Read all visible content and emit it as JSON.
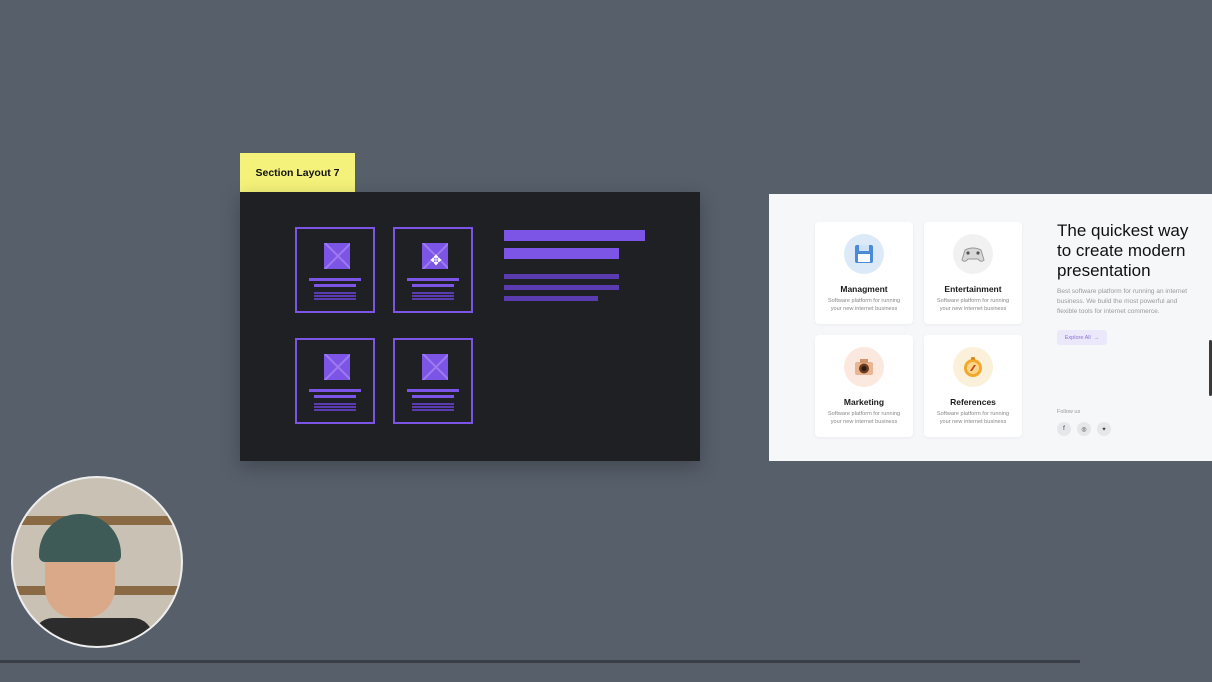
{
  "section_label": "Section Layout 7",
  "colors": {
    "background": "#575f6b",
    "wireframe_bg": "#1f2024",
    "wireframe_accent": "#7d55e6",
    "label_bg": "#f4f27a",
    "preview_bg": "#f6f7f9"
  },
  "preview": {
    "features": [
      {
        "title": "Managment",
        "desc": "Software platform for running your new internet business",
        "icon": "floppy-disk-icon"
      },
      {
        "title": "Entertainment",
        "desc": "Software platform for running your new internet business",
        "icon": "gamepad-icon"
      },
      {
        "title": "Marketing",
        "desc": "Software platform for running your new internet business",
        "icon": "camera-icon"
      },
      {
        "title": "References",
        "desc": "Software platform for running your new internet business",
        "icon": "compass-icon"
      }
    ],
    "hero_title": "The quickest way to create modern presentation",
    "hero_desc": "Best software platform for running an internet business. We build the most powerful and flexible tools for internet commerce.",
    "explore_label": "Explore All",
    "explore_arrow": "→",
    "follow_label": "Follow us",
    "socials": [
      {
        "name": "facebook",
        "glyph": "f"
      },
      {
        "name": "instagram",
        "glyph": "◎"
      },
      {
        "name": "twitter",
        "glyph": "✦"
      }
    ]
  },
  "progress": {
    "value": 1.0
  }
}
